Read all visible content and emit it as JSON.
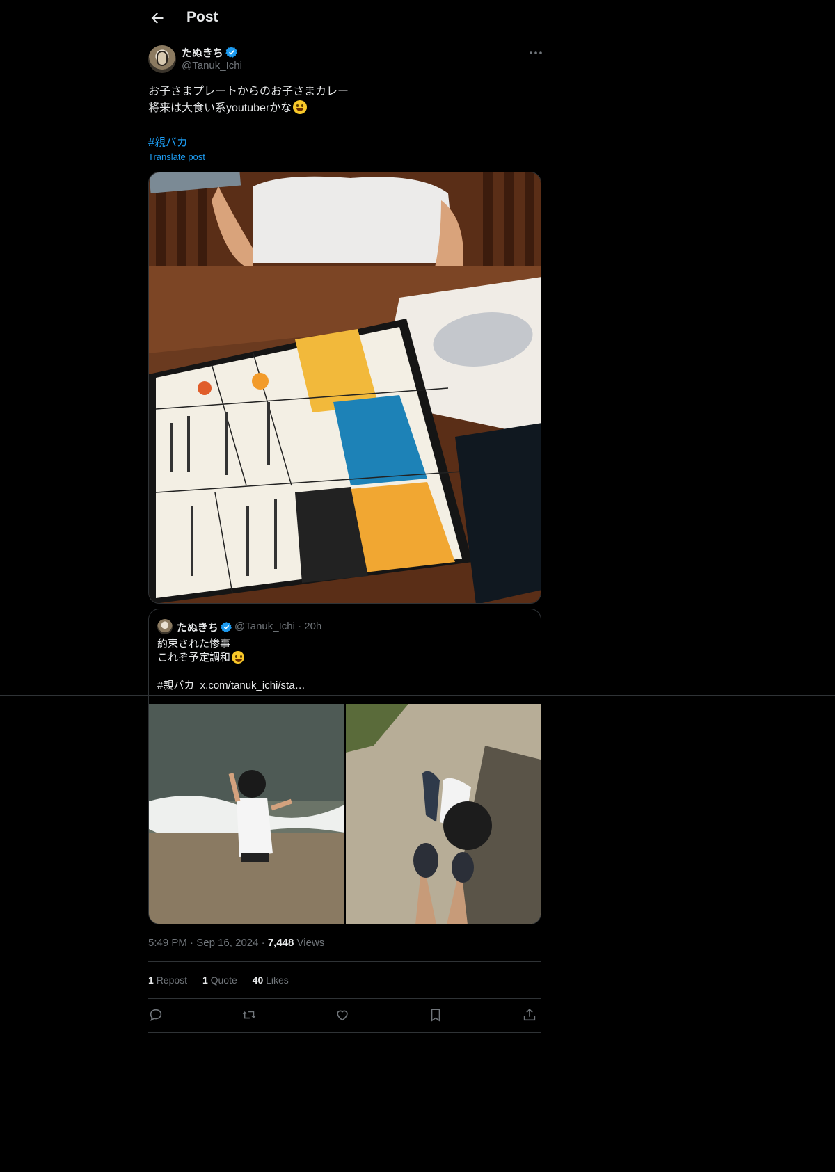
{
  "header": {
    "title": "Post"
  },
  "author": {
    "name": "たぬきち",
    "handle": "@Tanuk_Ichi"
  },
  "post": {
    "lines": [
      "お子さまプレートからのお子さまカレー",
      "将来は大食い系youtuberかな"
    ],
    "emoji": "grinning-face-emoji",
    "hashtag": "#親バカ",
    "translate": "Translate post"
  },
  "quote": {
    "name": "たぬきち",
    "handle": "@Tanuk_Ichi",
    "time": "20h",
    "lines": [
      "約束された惨事",
      "これぞ予定調和",
      "",
      "#親バカ  x.com/tanuk_ichi/sta…"
    ],
    "emoji": "smiling-face-with-halo-emoji"
  },
  "meta": {
    "time": "5:49 PM",
    "date": "Sep 16, 2024",
    "views_count": "7,448",
    "views_label": "Views"
  },
  "stats": {
    "reposts": {
      "count": "1",
      "label": "Repost"
    },
    "quotes": {
      "count": "1",
      "label": "Quote"
    },
    "likes": {
      "count": "40",
      "label": "Likes"
    }
  },
  "icons": [
    "back-arrow-icon",
    "verified-badge-icon",
    "more-icon",
    "reply-icon",
    "repost-icon",
    "like-icon",
    "bookmark-icon",
    "share-icon"
  ],
  "colors": {
    "background": "#000000",
    "accent": "#1d9bf0",
    "text": "#e7e9ea",
    "muted": "#71767b",
    "border": "#2f3336"
  }
}
